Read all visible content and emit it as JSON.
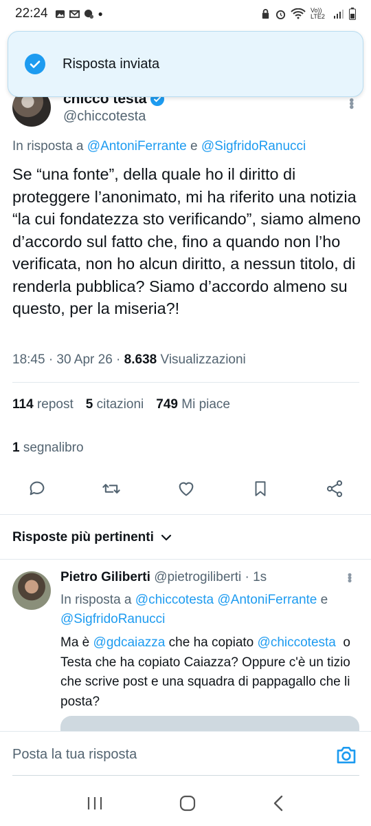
{
  "status_bar": {
    "time": "22:24",
    "left_icons": [
      "gallery-icon",
      "gmail-icon",
      "assistant-icon",
      "dot-icon"
    ],
    "right_icons": [
      "alarm-lock-icon",
      "alarm-icon",
      "wifi-icon",
      "volte-icon",
      "signal-icon",
      "battery-icon"
    ],
    "network_label": "Vo)) LTE2"
  },
  "toast": {
    "text": "Risposta inviata"
  },
  "tweet": {
    "author_name": "chicco testa",
    "author_handle": "@chiccotesta",
    "reply_prefix": "In risposta a ",
    "reply_user1": "@AntoniFerrante",
    "reply_joiner": " e ",
    "reply_user2": "@SigfridoRanucci",
    "text": "Se “una fonte”, della quale ho il diritto di proteggere l’anonimato, mi ha riferito una notizia “la cui fondatezza sto verificando”, siamo almeno d’accordo sul fatto che, fino a quando non l’ho verificata, non ho alcun diritto, a nessun titolo, di renderla pubblica? Siamo d’accordo almeno su questo, per la miseria?!",
    "time_date": "18:45 · 30 Apr 26 · ",
    "views_count": "8.638",
    "views_label": " Visualizzazioni",
    "reposts_count": "114",
    "reposts_label": "repost",
    "quotes_count": "5",
    "quotes_label": "citazioni",
    "likes_count": "749",
    "likes_label": "Mi piace",
    "bookmarks_count": "1",
    "bookmarks_label": "segnalibro"
  },
  "sort": {
    "label": "Risposte più pertinenti"
  },
  "reply": {
    "author_name": "Pietro Giliberti",
    "author_handle": "@pietrogiliberti",
    "age": " · 1s",
    "reply_prefix": "In risposta a ",
    "reply_user1": "@chiccotesta",
    "reply_user2": "@AntoniFerrante",
    "reply_joiner": " e ",
    "reply_user3": "@SigfridoRanucci",
    "text_before": "Ma è ",
    "mention1": "@gdcaiazza",
    "text_mid": " che ha copiato ",
    "mention2": "@chiccotesta",
    "text_after": "  o Testa che ha copiato Caiazza? Oppure c'è un tizio che scrive post e una squadra di pappagallo che li posta?"
  },
  "compose": {
    "placeholder": "Posta la tua risposta"
  },
  "colors": {
    "accent": "#1d9bf0",
    "text": "#0f1419",
    "muted": "#536471"
  }
}
